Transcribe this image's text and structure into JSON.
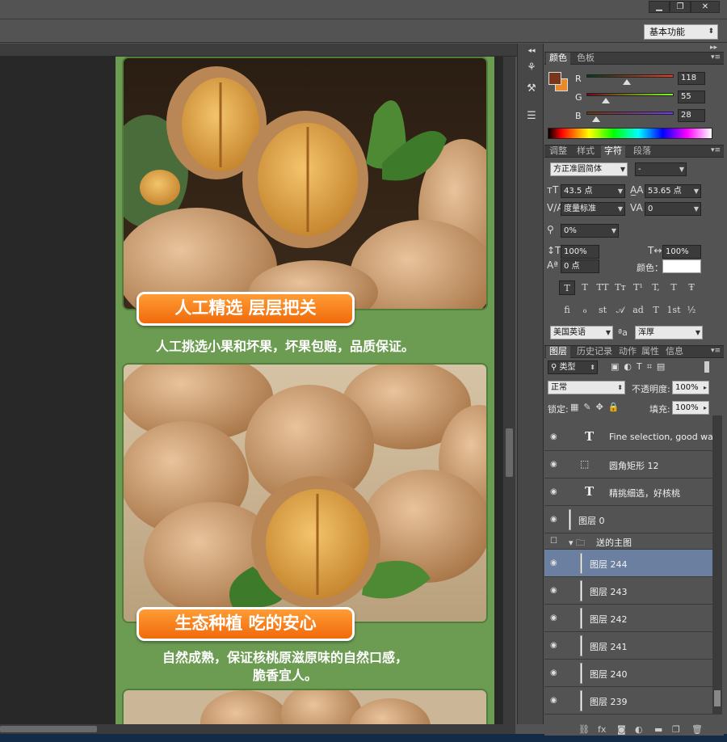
{
  "window": {
    "minimize": "▁",
    "restore": "❐",
    "close": "✕"
  },
  "workspace": {
    "value": "基本功能"
  },
  "canvas": {
    "banner1": "人工精选 层层把关",
    "caption1": "人工挑选小果和坏果，坏果包赔，品质保证。",
    "banner2": "生态种植 吃的安心",
    "caption2_line1": "自然成熟，保证核桃原滋原味的自然口感，",
    "caption2_line2": "脆香宜人。"
  },
  "color_panel": {
    "tabs": [
      "颜色",
      "色板"
    ],
    "foreground": "#76371c",
    "background": "#e8892c",
    "channels": [
      {
        "label": "R",
        "value": "118",
        "fraction": 0.46
      },
      {
        "label": "G",
        "value": "55",
        "fraction": 0.22
      },
      {
        "label": "B",
        "value": "28",
        "fraction": 0.11
      }
    ]
  },
  "char_panel": {
    "tabs": [
      "调整",
      "样式",
      "字符",
      "段落"
    ],
    "font_family": "方正准圆简体",
    "font_style": "-",
    "font_size": "43.5 点",
    "leading": "53.65 点",
    "kerning": "度量标准",
    "tracking": "0",
    "tsume": "0%",
    "vscale": "100%",
    "hscale": "100%",
    "baseline": "0 点",
    "color_label": "颜色：",
    "style_buttons": [
      "T",
      "T",
      "TT",
      "Tт",
      "T¹",
      "T,",
      "T",
      "Ŧ"
    ],
    "opentype_buttons": [
      "ﬁ",
      "ℴ",
      "st",
      "𝒜",
      "ad",
      "T",
      "1st",
      "½"
    ],
    "language": "美国英语",
    "aa_label": "ªa",
    "antialias": "浑厚"
  },
  "layers_panel": {
    "tabs": [
      "图层",
      "历史记录",
      "动作",
      "属性",
      "信息"
    ],
    "filter": "类型",
    "blend_mode": "正常",
    "opacity_label": "不透明度:",
    "opacity": "100%",
    "lock_label": "锁定:",
    "fill_label": "填充:",
    "fill": "100%",
    "layers": [
      {
        "name": "Fine selection, good wal...",
        "kind": "text"
      },
      {
        "name": "圆角矩形 12",
        "kind": "shape"
      },
      {
        "name": "精挑细选，好核桃",
        "kind": "text"
      },
      {
        "name": "图层 0",
        "kind": "pixel"
      },
      {
        "name": "送的主图",
        "kind": "group"
      },
      {
        "name": "图层 244",
        "kind": "pixel",
        "selected": true
      },
      {
        "name": "图层 243",
        "kind": "pixel"
      },
      {
        "name": "图层 242",
        "kind": "pixel"
      },
      {
        "name": "图层 241",
        "kind": "pixel"
      },
      {
        "name": "图层 240",
        "kind": "pixel"
      },
      {
        "name": "图层 239",
        "kind": "pixel"
      }
    ]
  }
}
